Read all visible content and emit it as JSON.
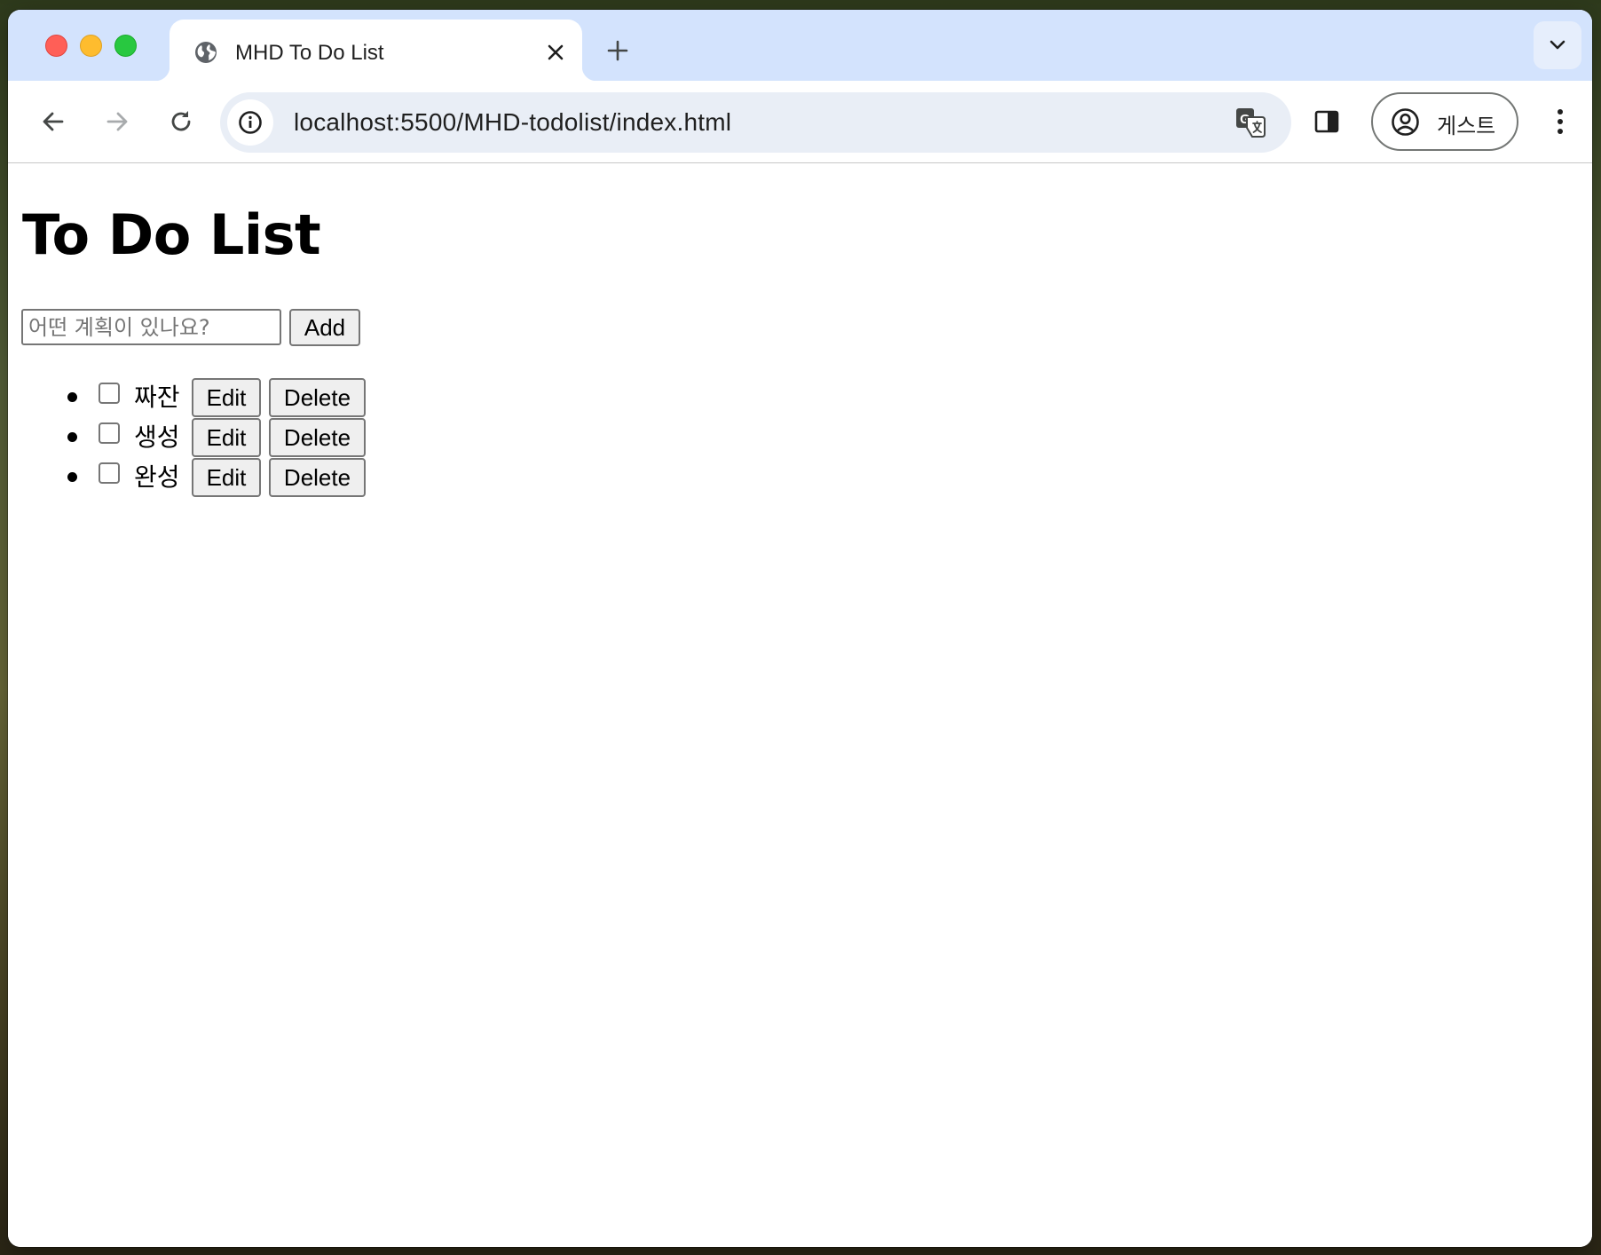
{
  "browser": {
    "tab": {
      "title": "MHD To Do List",
      "favicon": "globe-icon"
    },
    "url": "localhost:5500/MHD-todolist/index.html",
    "profile_label": "게스트",
    "colors": {
      "tabstrip": "#d3e3fd",
      "omnibox": "#e9eef6",
      "traffic_red": "#ff5f57",
      "traffic_yellow": "#febc2e",
      "traffic_green": "#28c840"
    }
  },
  "page": {
    "title": "To Do List",
    "input": {
      "value": "",
      "placeholder": "어떤 계획이 있나요?"
    },
    "add_label": "Add",
    "todos": [
      {
        "text": "짜잔",
        "checked": false,
        "edit_label": "Edit",
        "delete_label": "Delete"
      },
      {
        "text": "생성",
        "checked": false,
        "edit_label": "Edit",
        "delete_label": "Delete"
      },
      {
        "text": "완성",
        "checked": false,
        "edit_label": "Edit",
        "delete_label": "Delete"
      }
    ]
  }
}
